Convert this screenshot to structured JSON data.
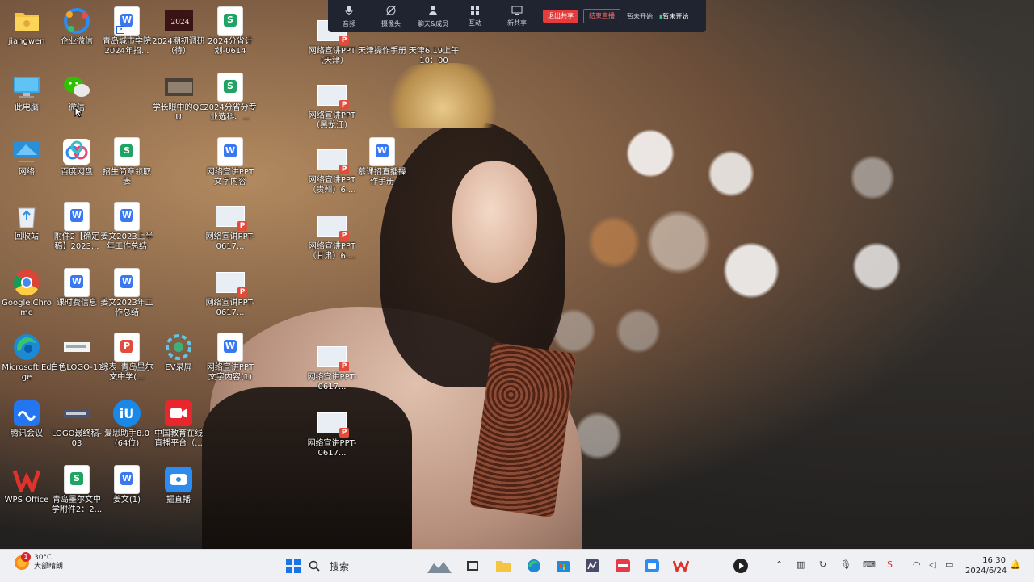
{
  "meeting_toolbar": {
    "buttons": [
      {
        "icon": "microphone-icon",
        "label": "音频"
      },
      {
        "icon": "camera-off-icon",
        "label": "摄像头"
      },
      {
        "icon": "user-icon",
        "label": "聊天&成员"
      },
      {
        "icon": "grid-icon",
        "label": "互动"
      },
      {
        "icon": "screen-share-icon",
        "label": "新共享"
      }
    ],
    "end_share_label": "退出共享",
    "stop_live_label": "结束直播",
    "pause_label": "暂未开始",
    "live_status": "暂未开始"
  },
  "desktop": {
    "icons": [
      {
        "label": "jiangwen",
        "icon": "folder-icon"
      },
      {
        "label": "企业微信",
        "icon": "wecom-icon"
      },
      {
        "label": "青岛城市学院2024年招...",
        "icon": "word-doc-icon"
      },
      {
        "label": "2024期初调研（待）",
        "icon": "image-thumbnail-icon"
      },
      {
        "label": "2024分省计划-0614",
        "icon": "sheet-doc-icon"
      },
      {
        "label": "网络宣讲PPT（天津）",
        "icon": "ppt-thumbnail-icon"
      },
      {
        "label": "天津操作手册",
        "icon": "document-icon"
      },
      {
        "label": "天津6.19上午10：00",
        "icon": "document-icon"
      },
      {
        "label": "此电脑",
        "icon": "computer-icon"
      },
      {
        "label": "微信",
        "icon": "wechat-icon"
      },
      {
        "label": "学长眼中的QCU",
        "icon": "video-thumbnail-icon"
      },
      {
        "label": "2024分省分专业选科、...",
        "icon": "sheet-doc-icon"
      },
      {
        "label": "网络宣讲PPT（黑龙江）",
        "icon": "ppt-thumbnail-icon"
      },
      {
        "label": "网络",
        "icon": "network-icon"
      },
      {
        "label": "百度网盘",
        "icon": "baidu-netdisk-icon"
      },
      {
        "label": "招生简章领取表",
        "icon": "sheet-doc-icon"
      },
      {
        "label": "网络宣讲PPT文字内容",
        "icon": "word-doc-icon"
      },
      {
        "label": "网络宣讲PPT（贵州）6....",
        "icon": "ppt-thumbnail-icon"
      },
      {
        "label": "慕课招直播操作手册",
        "icon": "word-doc-icon"
      },
      {
        "label": "回收站",
        "icon": "recycle-bin-icon"
      },
      {
        "label": "附件2【确定稿】2023...",
        "icon": "word-doc-icon"
      },
      {
        "label": "姜文2023上半年工作总结",
        "icon": "word-doc-icon"
      },
      {
        "label": "网络宣讲PPT-0617...",
        "icon": "ppt-thumbnail-icon"
      },
      {
        "label": "网络宣讲PPT（甘肃）6....",
        "icon": "ppt-thumbnail-icon"
      },
      {
        "label": "Google Chrome",
        "icon": "chrome-icon"
      },
      {
        "label": "课时费信息",
        "icon": "word-doc-icon"
      },
      {
        "label": "姜文2023年工作总结",
        "icon": "word-doc-icon"
      },
      {
        "label": "网络宣讲PPT-0617...",
        "icon": "ppt-thumbnail-icon"
      },
      {
        "label": "Microsoft Edge",
        "icon": "edge-icon"
      },
      {
        "label": "白色LOGO-11",
        "icon": "logo-thumbnail-icon"
      },
      {
        "label": "综表_青岛里尔文中学(...",
        "icon": "pdf-doc-icon"
      },
      {
        "label": "EV录屏",
        "icon": "ev-recorder-icon"
      },
      {
        "label": "网络宣讲PPT文字内容(1)",
        "icon": "word-doc-icon"
      },
      {
        "label": "网络宣讲PPT-0617...",
        "icon": "ppt-thumbnail-icon"
      },
      {
        "label": "腾讯会议",
        "icon": "tencent-meeting-icon"
      },
      {
        "label": "LOGO最终稿-03",
        "icon": "logo-thumbnail-icon"
      },
      {
        "label": "爱思助手8.0(64位)",
        "icon": "i4-assistant-icon"
      },
      {
        "label": "中国教育在线直播平台（...",
        "icon": "live-camera-icon"
      },
      {
        "label": "网络宣讲PPT-0617...",
        "icon": "ppt-thumbnail-icon"
      },
      {
        "label": "WPS Office",
        "icon": "wps-icon"
      },
      {
        "label": "青岛墨尔文中学附件2：2...",
        "icon": "sheet-doc-icon"
      },
      {
        "label": "姜文(1)",
        "icon": "word-doc-icon"
      },
      {
        "label": "掘直播",
        "icon": "live-app-icon"
      }
    ]
  },
  "taskbar": {
    "weather_temp": "30°C",
    "weather_desc": "大部晴朗",
    "notification_count": "1",
    "search_placeholder": "搜索",
    "time": "16:30",
    "date": "2024/6/24"
  },
  "colors": {
    "meeting_bar_bg": "#1f2430",
    "end_share_red": "#e53b3b",
    "taskbar_bg": "#eef0f4"
  }
}
